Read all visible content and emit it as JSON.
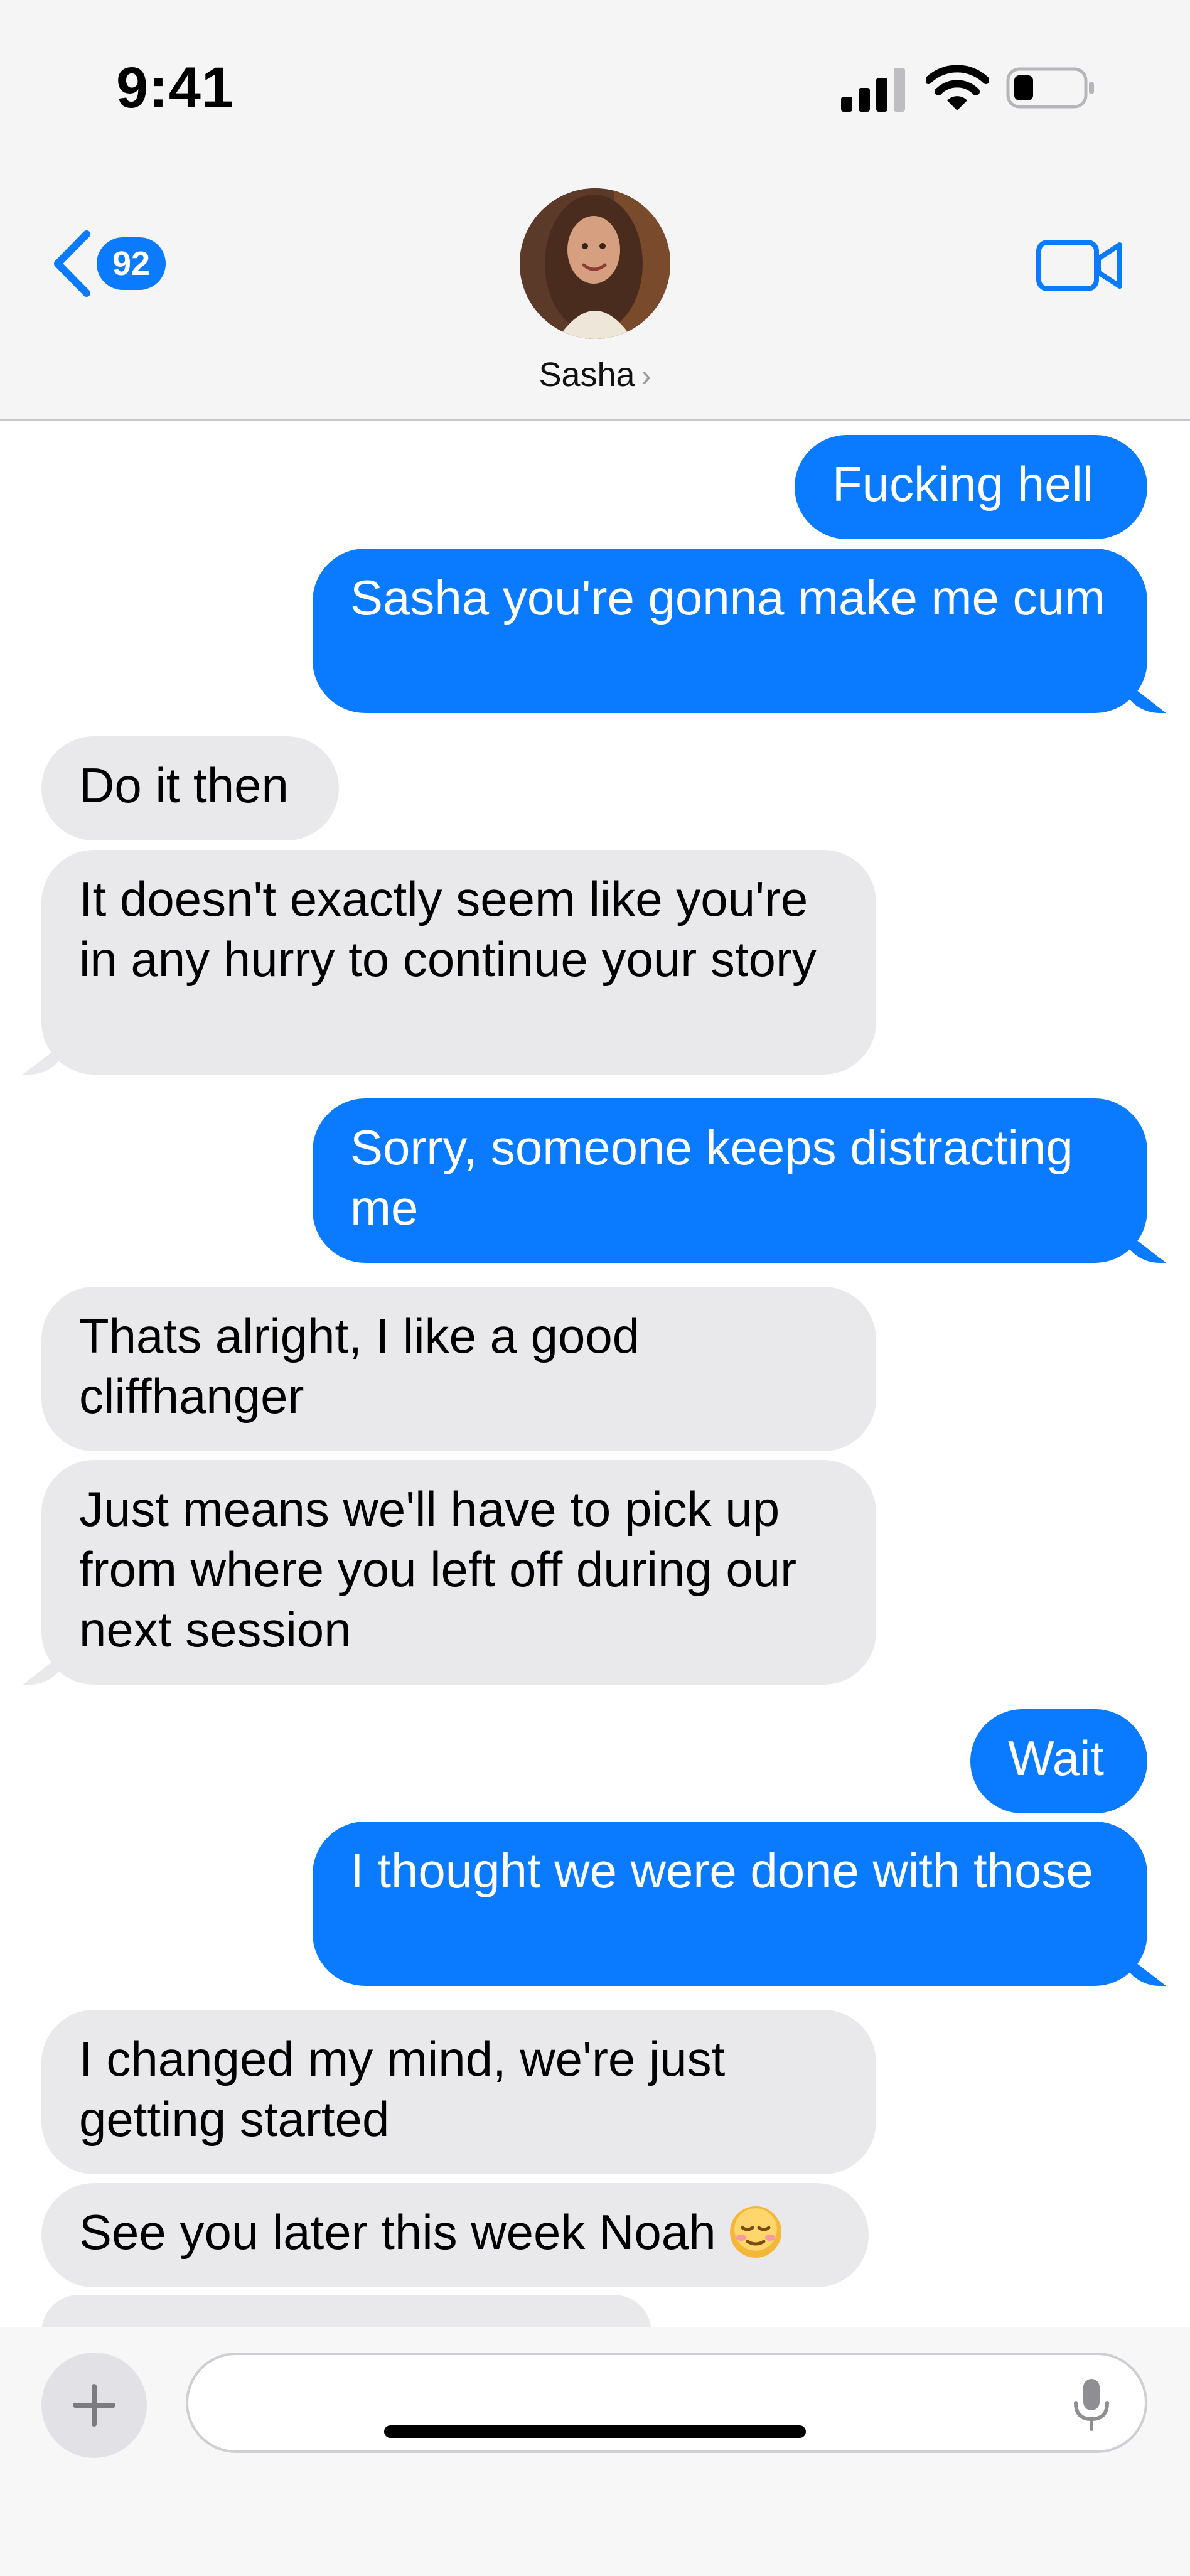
{
  "status_bar": {
    "time": "9:41"
  },
  "header": {
    "back_count": "92",
    "contact_name": "Sasha",
    "chevron": "›"
  },
  "messages": [
    {
      "direction": "outgoing",
      "text": "Fucking hell"
    },
    {
      "direction": "outgoing",
      "text": "Sasha you're gonna make me cum"
    },
    {
      "direction": "incoming",
      "text": "Do it then"
    },
    {
      "direction": "incoming",
      "text": "It doesn't exactly seem like you're in any hurry to continue your story"
    },
    {
      "direction": "outgoing",
      "text": "Sorry, someone keeps distracting me"
    },
    {
      "direction": "incoming",
      "text": "Thats alright, I like a good cliffhanger"
    },
    {
      "direction": "incoming",
      "text": "Just means we'll have to pick up from where you left off during our next session"
    },
    {
      "direction": "outgoing",
      "text": "Wait"
    },
    {
      "direction": "outgoing",
      "text": "I thought we were done with those"
    },
    {
      "direction": "incoming",
      "text": "I changed my mind, we're just getting started"
    },
    {
      "direction": "incoming",
      "text": "See you later this week Noah",
      "emoji": "relieved-face"
    }
  ],
  "composer": {
    "placeholder": ""
  },
  "colors": {
    "accent": "#0a7aff",
    "incoming_bubble": "#e9e9eb",
    "outgoing_text": "#ffffff"
  },
  "icons": [
    "back-chevron-icon",
    "video-camera-icon",
    "plus-icon",
    "microphone-icon",
    "signal-icon",
    "wifi-icon",
    "battery-icon",
    "relieved-face-emoji"
  ]
}
